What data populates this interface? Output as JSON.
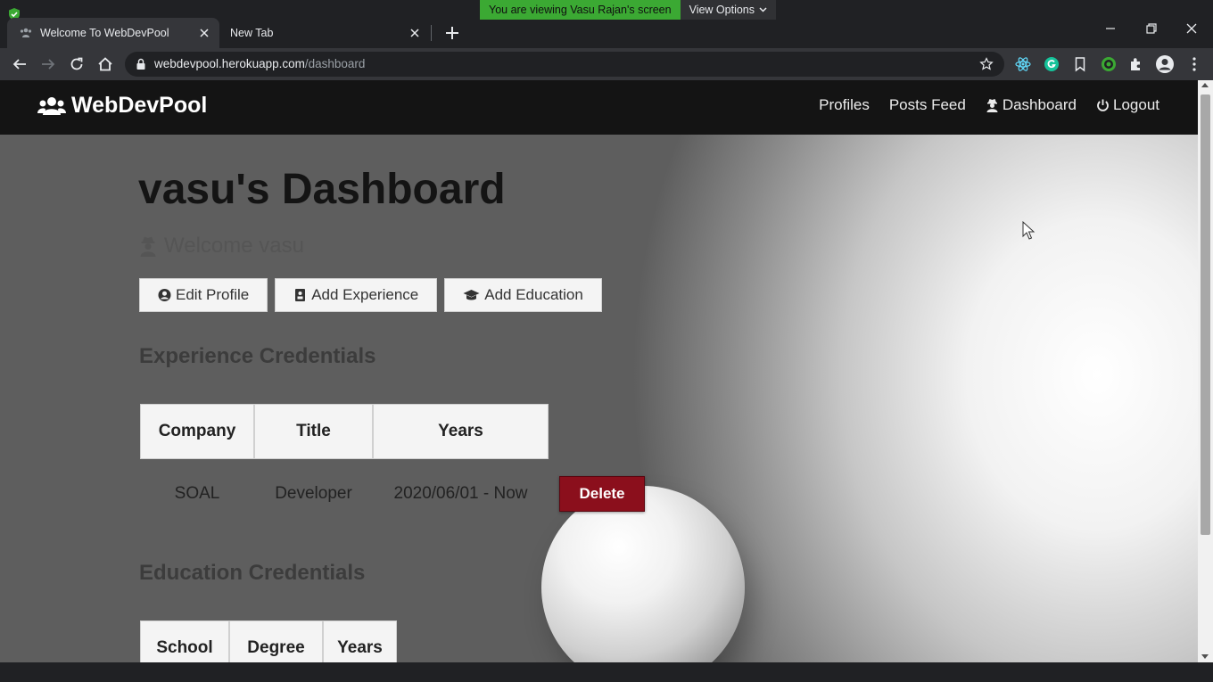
{
  "browser": {
    "share_banner": {
      "message": "You are viewing Vasu Rajan's screen",
      "options_label": "View Options"
    },
    "tabs": [
      {
        "title": "Welcome To WebDevPool",
        "active": true
      },
      {
        "title": "New Tab",
        "active": false
      }
    ],
    "url": {
      "host": "webdevpool.herokuapp.com",
      "path": "/dashboard"
    }
  },
  "navbar": {
    "brand": "WebDevPool",
    "links": [
      {
        "label": "Profiles",
        "icon": ""
      },
      {
        "label": "Posts Feed",
        "icon": ""
      },
      {
        "label": "Dashboard",
        "icon": "user-secret-icon"
      },
      {
        "label": "Logout",
        "icon": "power-icon"
      }
    ]
  },
  "dashboard": {
    "title": "vasu's Dashboard",
    "welcome": "Welcome vasu",
    "actions": [
      {
        "label": "Edit Profile",
        "icon": "user-circle-icon"
      },
      {
        "label": "Add Experience",
        "icon": "id-badge-icon"
      },
      {
        "label": "Add Education",
        "icon": "graduation-cap-icon"
      }
    ],
    "experience": {
      "heading": "Experience Credentials",
      "columns": [
        "Company",
        "Title",
        "Years"
      ],
      "rows": [
        {
          "company": "SOAL",
          "title": "Developer",
          "years": "2020/06/01 - Now",
          "action": "Delete"
        }
      ]
    },
    "education": {
      "heading": "Education Credentials",
      "columns": [
        "School",
        "Degree",
        "Years"
      ]
    }
  },
  "colors": {
    "navbar_bg": "#141414",
    "delete_button": "#8b0f1c",
    "share_banner": "#3ba933"
  }
}
